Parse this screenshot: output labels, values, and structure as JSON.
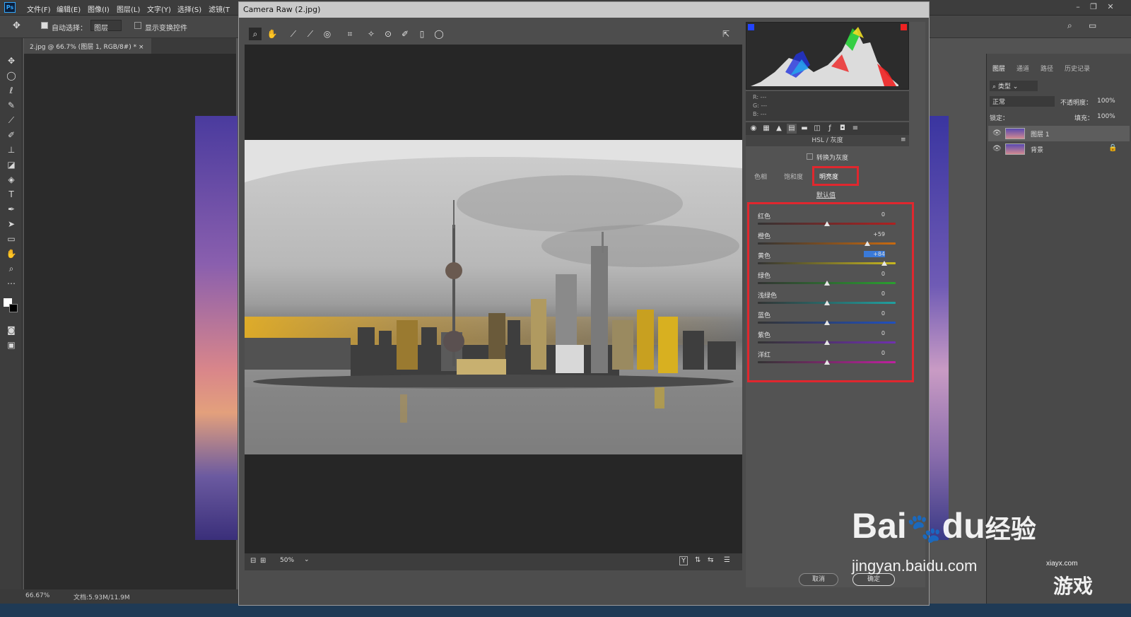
{
  "menubar": {
    "logo": "Ps",
    "items": [
      "文件(F)",
      "编辑(E)",
      "图像(I)",
      "图层(L)",
      "文字(Y)",
      "选择(S)",
      "滤镜(T"
    ]
  },
  "options": {
    "auto_select_label": "自动选择：",
    "auto_select_value": "图层",
    "show_transform_label": "显示变换控件"
  },
  "document_tab": {
    "label": "2.jpg @ 66.7% (图层 1, RGB/8#) *"
  },
  "status": {
    "zoom": "66.67%",
    "doc": "文档:5.93M/11.9M"
  },
  "layers_panel": {
    "tabs": [
      "图层",
      "通道",
      "路径",
      "历史记录"
    ],
    "filter_label": "类型",
    "blend_mode": "正常",
    "opacity_label": "不透明度：",
    "opacity_value": "100%",
    "lock_label": "锁定：",
    "fill_label": "填充：",
    "fill_value": "100%",
    "layers": [
      {
        "name": "图层 1",
        "locked": false
      },
      {
        "name": "背景",
        "locked": true
      }
    ]
  },
  "camera_raw": {
    "title": "Camera Raw (2.jpg)",
    "readout": {
      "r": "R: ---",
      "g": "G: ---",
      "b": "B: ---"
    },
    "panel_title": "HSL / 灰度",
    "convert_gray_label": "转换为灰度",
    "tabs": [
      {
        "label": "色相",
        "active": false
      },
      {
        "label": "饱和度",
        "active": false
      },
      {
        "label": "明亮度",
        "active": true
      }
    ],
    "default_label": "默认值",
    "sliders": [
      {
        "label": "红色",
        "value": "0",
        "level": 0,
        "color": "linear-gradient(90deg,#333,#b02020)"
      },
      {
        "label": "橙色",
        "value": "+59",
        "level": 59,
        "color": "linear-gradient(90deg,#333,#c86a10)"
      },
      {
        "label": "黄色",
        "value": "+84",
        "level": 84,
        "color": "linear-gradient(90deg,#333,#c8b820)",
        "highlight": true
      },
      {
        "label": "绿色",
        "value": "0",
        "level": 0,
        "color": "linear-gradient(90deg,#333,#2aa030)"
      },
      {
        "label": "浅绿色",
        "value": "0",
        "level": 0,
        "color": "linear-gradient(90deg,#333,#20a0a0)"
      },
      {
        "label": "蓝色",
        "value": "0",
        "level": 0,
        "color": "linear-gradient(90deg,#333,#2050c0)"
      },
      {
        "label": "紫色",
        "value": "0",
        "level": 0,
        "color": "linear-gradient(90deg,#333,#7030b0)"
      },
      {
        "label": "洋红",
        "value": "0",
        "level": 0,
        "color": "linear-gradient(90deg,#333,#c020a0)"
      }
    ],
    "zoom": "50%",
    "cancel_label": "取消",
    "ok_label": "确定",
    "highlight_color": "#e0272e"
  },
  "watermark": {
    "brand": "Bai",
    "brand2": "du",
    "brand3": "经验",
    "url": "jingyan.baidu.com",
    "site": "xiayx.com",
    "game": "游戏"
  }
}
